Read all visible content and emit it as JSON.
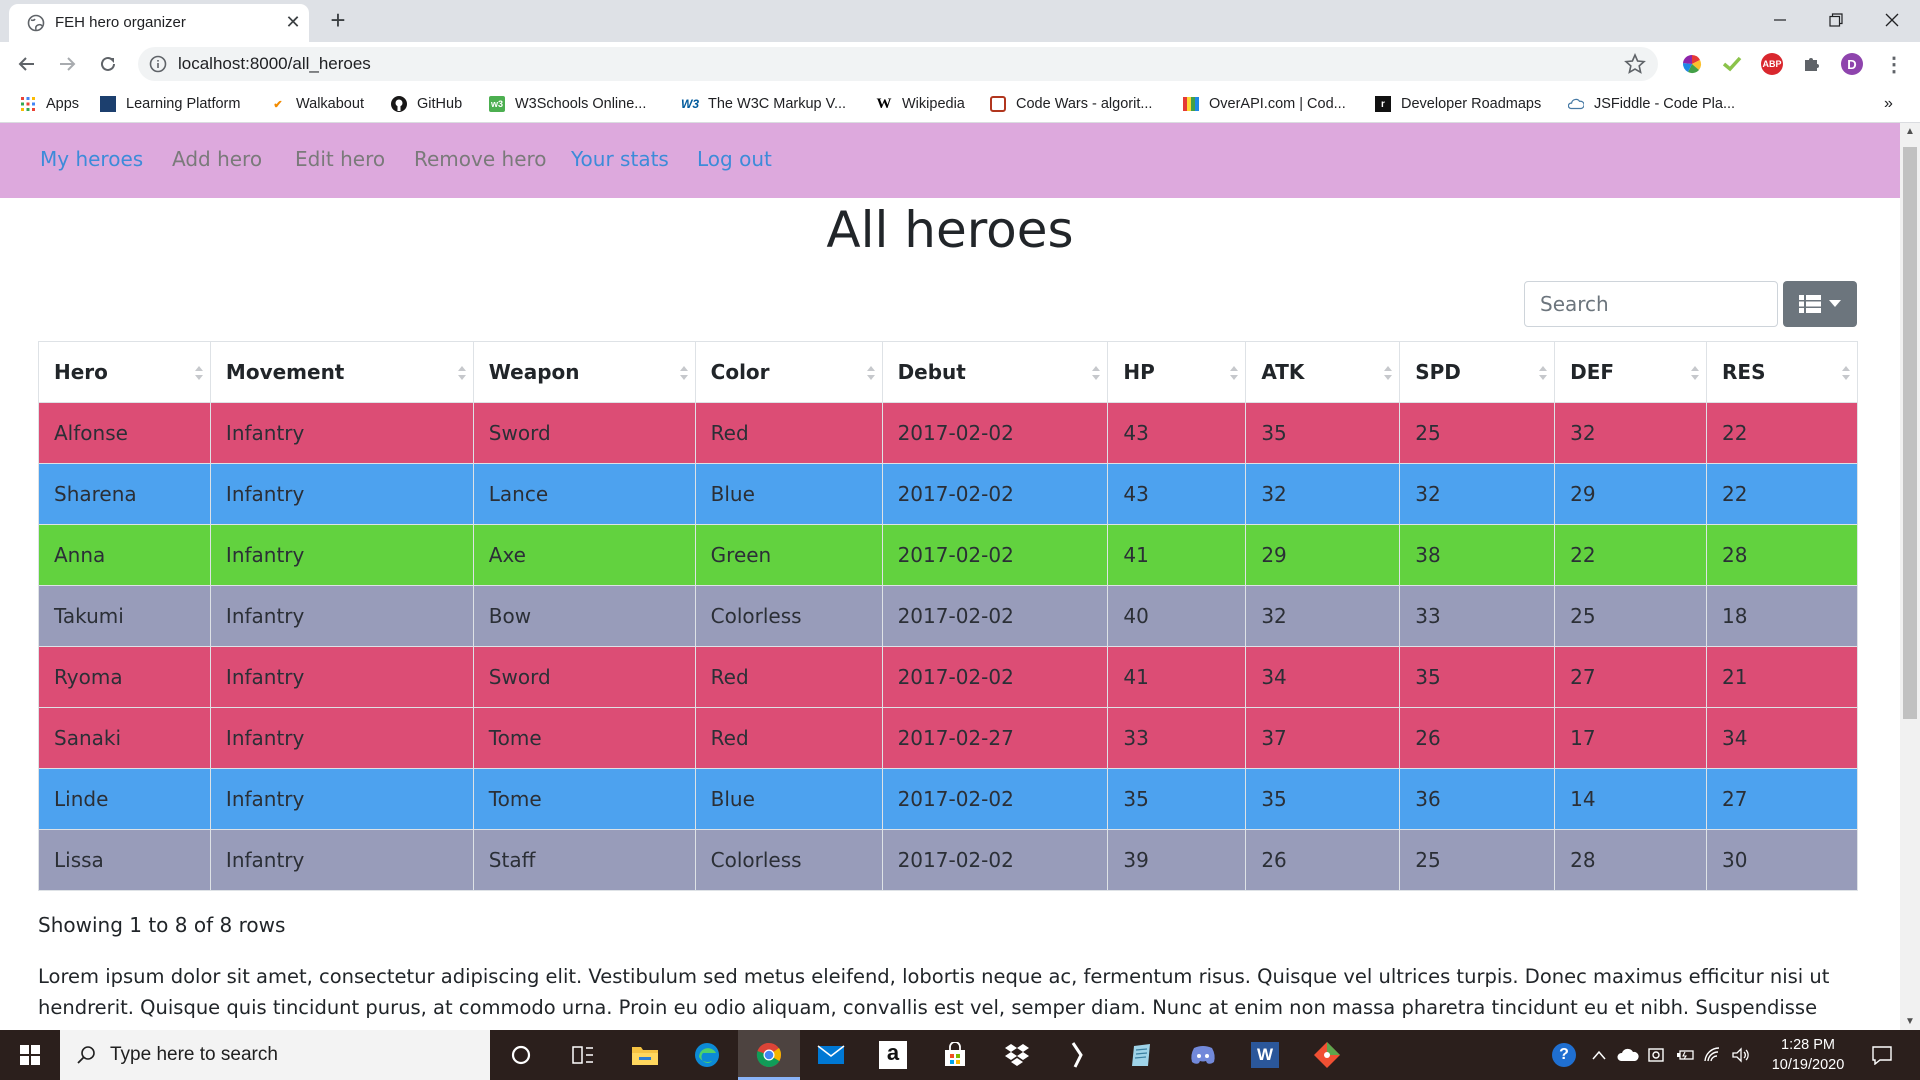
{
  "browser": {
    "tab_title": "FEH hero organizer",
    "tab_close": "✕",
    "new_tab": "+",
    "url": "localhost:8000/all_heroes",
    "bookmarks": [
      {
        "label": "Apps",
        "icon": "apps-grid-icon"
      },
      {
        "label": "Learning Platform",
        "icon": "learning-platform-icon"
      },
      {
        "label": "Walkabout",
        "icon": "walkabout-icon"
      },
      {
        "label": "GitHub",
        "icon": "github-icon"
      },
      {
        "label": "W3Schools Online...",
        "icon": "w3schools-icon"
      },
      {
        "label": "The W3C Markup V...",
        "icon": "w3c-icon"
      },
      {
        "label": "Wikipedia",
        "icon": "wikipedia-icon"
      },
      {
        "label": "Code Wars - algorit...",
        "icon": "codewars-icon"
      },
      {
        "label": "OverAPI.com | Cod...",
        "icon": "overapi-icon"
      },
      {
        "label": "Developer Roadmaps",
        "icon": "roadmaps-icon"
      },
      {
        "label": "JSFiddle - Code Pla...",
        "icon": "jsfiddle-icon"
      }
    ],
    "bookmarks_overflow": "»",
    "extensions": [
      "color-picker-icon",
      "vue-devtools-icon",
      "adblock-icon",
      "extensions-puzzle-icon"
    ],
    "adblock_label": "ABP",
    "profile_initial": "D"
  },
  "nav": {
    "items": [
      {
        "label": "My heroes",
        "color": "#3d8bd9"
      },
      {
        "label": "Add hero",
        "color": "#7a7a7a"
      },
      {
        "label": "Edit hero",
        "color": "#7a7a7a"
      },
      {
        "label": "Remove hero",
        "color": "#7a7a7a"
      },
      {
        "label": "Your stats",
        "color": "#3d8bd9"
      },
      {
        "label": "Log out",
        "color": "#3d8bd9"
      }
    ],
    "background": "#dda9dd"
  },
  "page": {
    "title": "All heroes",
    "search_placeholder": "Search",
    "showing": "Showing 1 to 8 of 8 rows",
    "lorem": "Lorem ipsum dolor sit amet, consectetur adipiscing elit. Vestibulum sed metus eleifend, lobortis neque ac, fermentum risus. Quisque vel ultrices turpis. Donec maximus efficitur nisi ut hendrerit. Quisque quis tincidunt purus, at commodo urna. Proin eu odio aliquam, convallis est vel, semper diam. Nunc at enim non massa pharetra tincidunt eu et nibh. Suspendisse potenti. Phasellus eu auctor ex."
  },
  "table": {
    "columns": [
      "Hero",
      "Movement",
      "Weapon",
      "Color",
      "Debut",
      "HP",
      "ATK",
      "SPD",
      "DEF",
      "RES"
    ],
    "color_map": {
      "Red": "#dc4d75",
      "Blue": "#4da2ef",
      "Green": "#62d23f",
      "Colorless": "#989cba"
    },
    "rows": [
      [
        "Alfonse",
        "Infantry",
        "Sword",
        "Red",
        "2017-02-02",
        "43",
        "35",
        "25",
        "32",
        "22"
      ],
      [
        "Sharena",
        "Infantry",
        "Lance",
        "Blue",
        "2017-02-02",
        "43",
        "32",
        "32",
        "29",
        "22"
      ],
      [
        "Anna",
        "Infantry",
        "Axe",
        "Green",
        "2017-02-02",
        "41",
        "29",
        "38",
        "22",
        "28"
      ],
      [
        "Takumi",
        "Infantry",
        "Bow",
        "Colorless",
        "2017-02-02",
        "40",
        "32",
        "33",
        "25",
        "18"
      ],
      [
        "Ryoma",
        "Infantry",
        "Sword",
        "Red",
        "2017-02-02",
        "41",
        "34",
        "35",
        "27",
        "21"
      ],
      [
        "Sanaki",
        "Infantry",
        "Tome",
        "Red",
        "2017-02-27",
        "33",
        "37",
        "26",
        "17",
        "34"
      ],
      [
        "Linde",
        "Infantry",
        "Tome",
        "Blue",
        "2017-02-02",
        "35",
        "35",
        "36",
        "14",
        "27"
      ],
      [
        "Lissa",
        "Infantry",
        "Staff",
        "Colorless",
        "2017-02-02",
        "39",
        "26",
        "25",
        "28",
        "30"
      ]
    ]
  },
  "taskbar": {
    "search_placeholder": "Type here to search",
    "apps": [
      "cortana-icon",
      "task-view-icon",
      "file-explorer-icon",
      "edge-icon",
      "chrome-icon",
      "mail-icon",
      "amazon-icon",
      "store-icon",
      "dropbox-icon",
      "slash-app-icon",
      "notepad-icon",
      "discord-icon",
      "word-icon",
      "git-icon"
    ],
    "word_letter": "W",
    "amazon_letter": "a",
    "help_glyph": "?",
    "time": "1:28 PM",
    "date": "10/19/2020"
  }
}
